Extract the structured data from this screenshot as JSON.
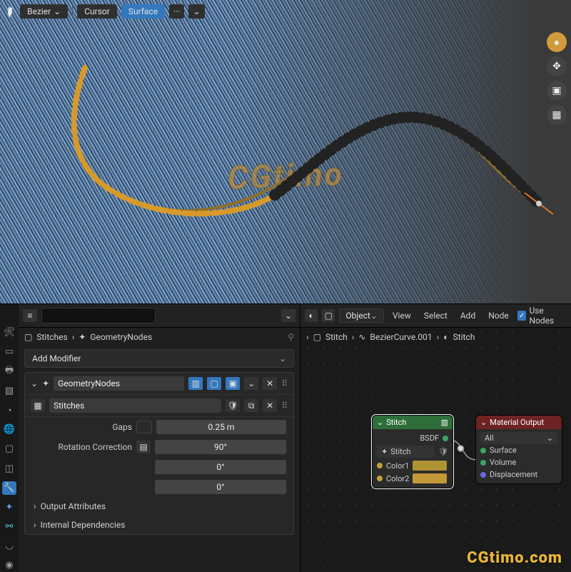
{
  "viewport": {
    "toolbar": {
      "mode": "Bezier",
      "pivot": "Cursor",
      "snap": "Surface",
      "more": "···"
    },
    "gizmos": [
      "axis",
      "move",
      "camera",
      "grid"
    ],
    "watermark": "CGtimo",
    "watermark_url": "CGtimo.com"
  },
  "properties": {
    "search_placeholder": "",
    "breadcrumb": {
      "obj": "Stitches",
      "mod": "GeometryNodes"
    },
    "add_modifier": "Add Modifier",
    "modifier": {
      "name": "GeometryNodes",
      "nodegroup": "Stitches",
      "params": {
        "gaps_label": "Gaps",
        "gaps_value": "0.25 m",
        "rot_label": "Rotation Correction",
        "rot_values": [
          "90°",
          "0°",
          "0°"
        ]
      },
      "sections": {
        "output_attrs": "Output Attributes",
        "internal_deps": "Internal Dependencies"
      }
    },
    "vertical_tabs": [
      "tool",
      "render",
      "output",
      "view",
      "scene",
      "world",
      "object",
      "modifier",
      "wrench",
      "physics",
      "constraint",
      "data",
      "material"
    ]
  },
  "shader": {
    "mode": "Object",
    "menus": [
      "View",
      "Select",
      "Add",
      "Node"
    ],
    "use_nodes_label": "Use Nodes",
    "breadcrumb": {
      "obj": "Stitch",
      "curve": "BezierCurve.001",
      "mat": "Stitch"
    },
    "node_stitch": {
      "title": "Stitch",
      "out": "BSDF",
      "group": "Stitch",
      "in1": "Color1",
      "in2": "Color2",
      "color1": "#b09332",
      "color2": "#c29938"
    },
    "node_output": {
      "title": "Material Output",
      "target": "All",
      "s1": "Surface",
      "s2": "Volume",
      "s3": "Displacement"
    }
  }
}
